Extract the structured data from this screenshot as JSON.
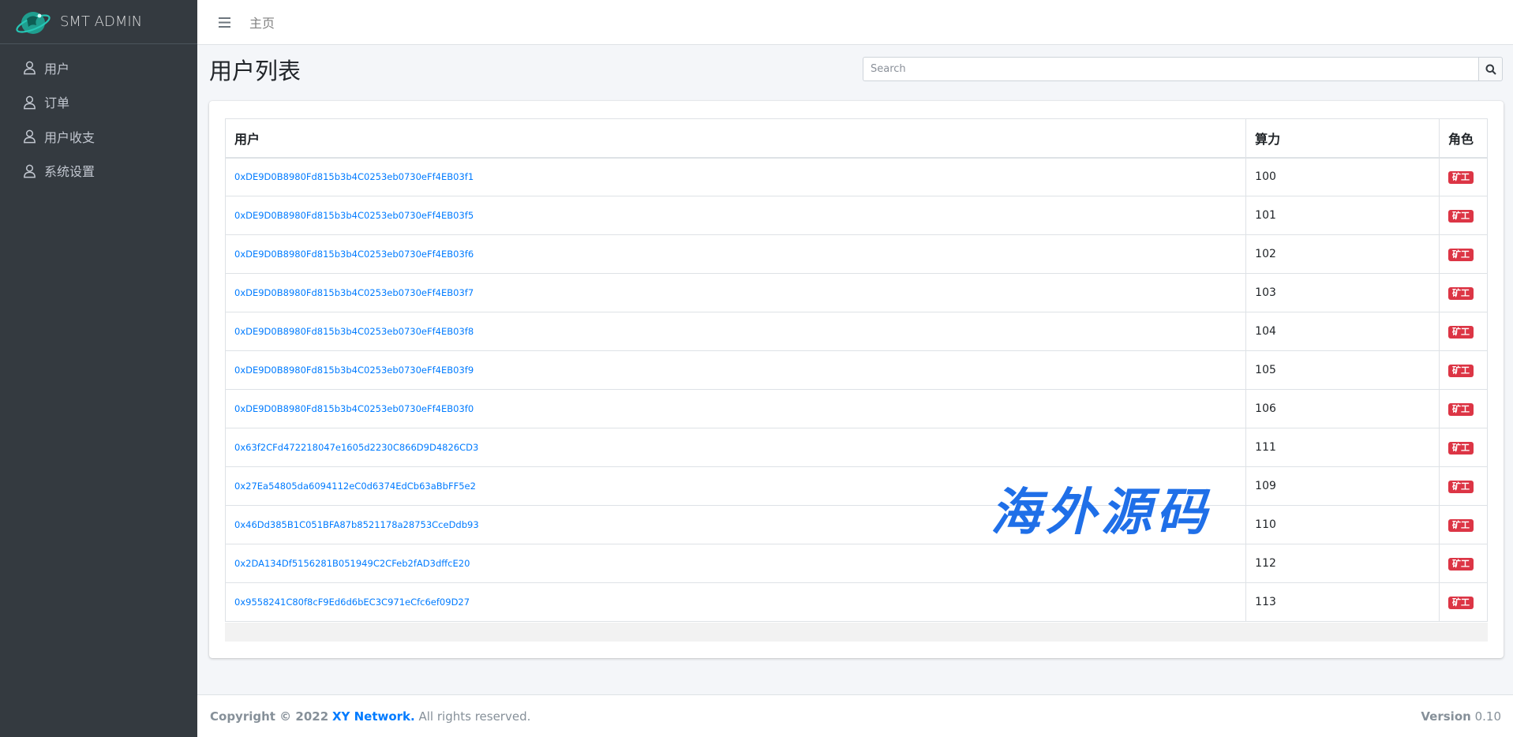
{
  "brand": {
    "name": "SMT ADMIN"
  },
  "sidebar": {
    "items": [
      {
        "label": "用户",
        "icon": "user-icon"
      },
      {
        "label": "订单",
        "icon": "user-icon"
      },
      {
        "label": "用户收支",
        "icon": "user-icon"
      },
      {
        "label": "系统设置",
        "icon": "user-icon"
      }
    ]
  },
  "header": {
    "home": "主页"
  },
  "page": {
    "title": "用户列表"
  },
  "search": {
    "placeholder": "Search"
  },
  "table": {
    "columns": [
      "用户",
      "算力",
      "角色"
    ],
    "rows": [
      {
        "user": "0xDE9D0B8980Fd815b3b4C0253eb0730eFf4EB03f1",
        "power": "100",
        "role": "矿工"
      },
      {
        "user": "0xDE9D0B8980Fd815b3b4C0253eb0730eFf4EB03f5",
        "power": "101",
        "role": "矿工"
      },
      {
        "user": "0xDE9D0B8980Fd815b3b4C0253eb0730eFf4EB03f6",
        "power": "102",
        "role": "矿工"
      },
      {
        "user": "0xDE9D0B8980Fd815b3b4C0253eb0730eFf4EB03f7",
        "power": "103",
        "role": "矿工"
      },
      {
        "user": "0xDE9D0B8980Fd815b3b4C0253eb0730eFf4EB03f8",
        "power": "104",
        "role": "矿工"
      },
      {
        "user": "0xDE9D0B8980Fd815b3b4C0253eb0730eFf4EB03f9",
        "power": "105",
        "role": "矿工"
      },
      {
        "user": "0xDE9D0B8980Fd815b3b4C0253eb0730eFf4EB03f0",
        "power": "106",
        "role": "矿工"
      },
      {
        "user": "0x63f2CFd472218047e1605d2230C866D9D4826CD3",
        "power": "111",
        "role": "矿工"
      },
      {
        "user": "0x27Ea54805da6094112eC0d6374EdCb63aBbFF5e2",
        "power": "109",
        "role": "矿工"
      },
      {
        "user": "0x46Dd385B1C051BFA87b8521178a28753CceDdb93",
        "power": "110",
        "role": "矿工"
      },
      {
        "user": "0x2DA134Df5156281B051949C2CFeb2fAD3dffcE20",
        "power": "112",
        "role": "矿工"
      },
      {
        "user": "0x9558241C80f8cF9Ed6d6bEC3C971eCfc6ef09D27",
        "power": "113",
        "role": "矿工"
      }
    ]
  },
  "watermark": "海外源码",
  "footer": {
    "copyright_prefix": "Copyright © 2022",
    "company": "XY Network.",
    "rights": "All rights reserved.",
    "version_label": "Version",
    "version": "0.10"
  },
  "colors": {
    "sidebar": "#343a40",
    "link": "#007bff",
    "badge": "#dc3545"
  }
}
